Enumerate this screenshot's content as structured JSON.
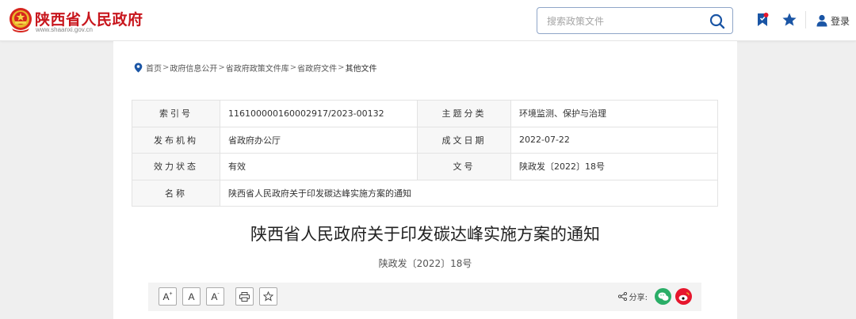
{
  "header": {
    "site_title": "陕西省人民政府",
    "site_url": "www.shaanxi.gov.cn",
    "search_placeholder": "搜索政策文件",
    "login_label": "登录",
    "colors": {
      "brand_red": "#c8161d",
      "icon_blue": "#1a55a5"
    },
    "icons": [
      "emblem-logo",
      "search-icon",
      "bookmark-icon",
      "star-icon",
      "user-icon"
    ]
  },
  "breadcrumb": {
    "items": [
      "首页",
      "政府信息公开",
      "省政府政策文件库",
      "省政府文件",
      "其他文件"
    ],
    "separator": ">"
  },
  "meta": {
    "index_no_label": "索引号",
    "index_no": "116100000160002917/2023-00132",
    "topic_label": "主题分类",
    "topic": "环境监测、保护与治理",
    "issuer_label": "发布机构",
    "issuer": "省政府办公厅",
    "date_label": "成文日期",
    "date": "2022-07-22",
    "status_label": "效力状态",
    "status": "有效",
    "docno_label": "文号",
    "docno": "陕政发〔2022〕18号",
    "name_label": "名称",
    "name": "陕西省人民政府关于印发碳达峰实施方案的通知"
  },
  "document": {
    "title": "陕西省人民政府关于印发碳达峰实施方案的通知",
    "number": "陕政发〔2022〕18号"
  },
  "toolbar": {
    "font_up": "A",
    "font_up_sup": "+",
    "font_normal": "A",
    "font_down": "A",
    "font_down_sup": "-",
    "share_label": "分享:",
    "share_icons": [
      "wechat-icon",
      "weibo-icon"
    ],
    "colors": {
      "wechat": "#2aae67",
      "weibo": "#e6162d"
    }
  }
}
